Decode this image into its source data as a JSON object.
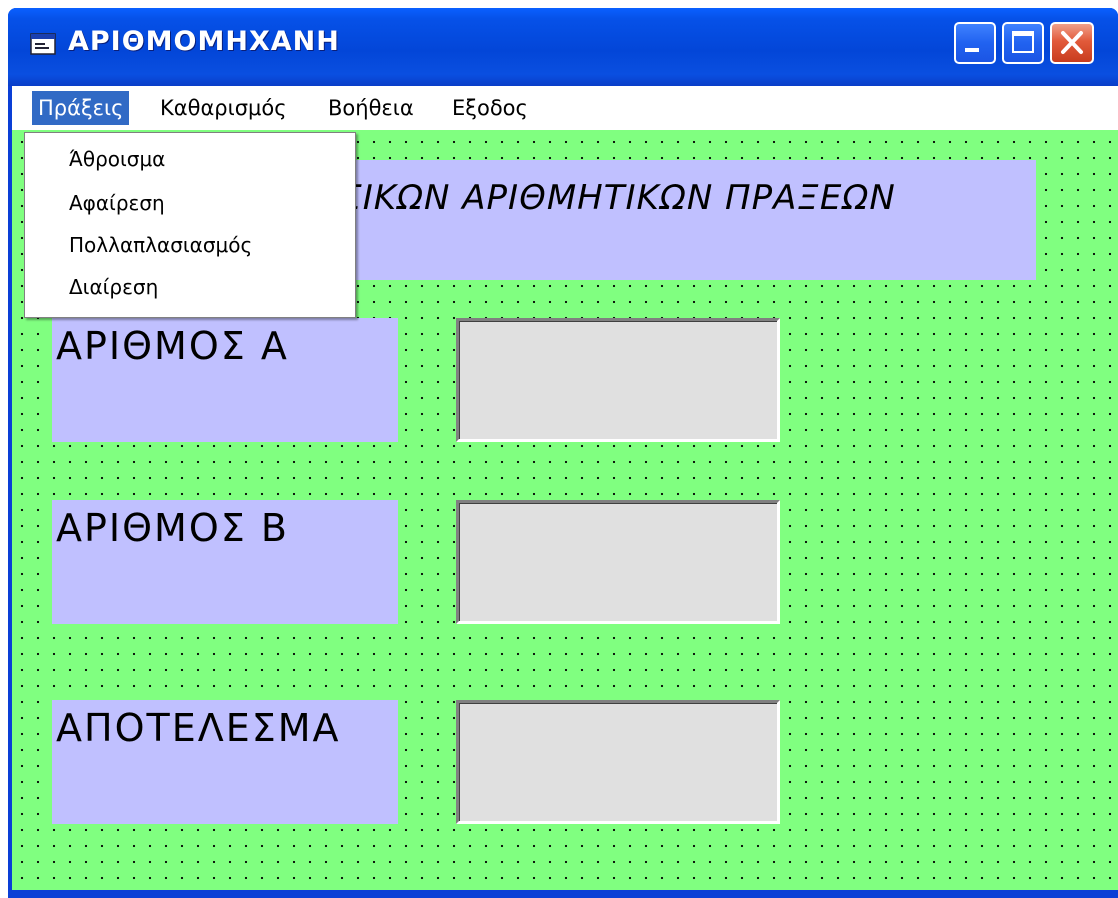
{
  "window": {
    "title": "ΑΡΙΘΜΟΜΗΧΑΝΗ",
    "accent": "#0a48dc",
    "close_color": "#e0502e"
  },
  "menubar": {
    "items": [
      {
        "label": "Πράξεις",
        "active": true
      },
      {
        "label": "Καθαρισμός",
        "active": false
      },
      {
        "label": "Βοήθεια",
        "active": false
      },
      {
        "label": "Εξοδος",
        "active": false
      }
    ]
  },
  "dropdown": {
    "items": [
      "Άθροισμα",
      "Αφαίρεση",
      "Πολλαπλασιασμός",
      "Διαίρεση"
    ]
  },
  "form": {
    "background": "#80ff80",
    "label_color": "#c0c0ff",
    "title_visible": "ΑΣΙΚΩΝ  ΑΡΙΘΜΗΤΙΚΩΝ ΠΡΑΞΕΩΝ",
    "fields": [
      {
        "label": "ΑΡΙΘΜΟΣ  Α",
        "value": ""
      },
      {
        "label": "ΑΡΙΘΜΟΣ  Β",
        "value": ""
      },
      {
        "label": "ΑΠΟΤΕΛΕΣΜΑ",
        "value": ""
      }
    ]
  },
  "icons": {
    "app": "form-icon",
    "minimize": "minimize-icon",
    "maximize": "maximize-icon",
    "close": "close-icon"
  }
}
